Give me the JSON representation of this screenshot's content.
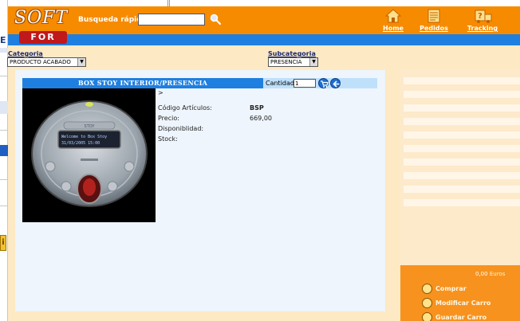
{
  "header": {
    "logo_top": "SOFT",
    "logo_bottom": "FOR YOU",
    "search_label": "Busqueda rápida",
    "search_value": "",
    "nav": [
      {
        "label": "Home",
        "icon": "home-icon"
      },
      {
        "label": "Pedidos",
        "icon": "document-icon"
      },
      {
        "label": "Tracking",
        "icon": "tracking-icon"
      }
    ]
  },
  "filters": {
    "categoria_label": "Categoria",
    "categoria_value": "PRODUCTO ACABADO",
    "subcategoria_label": "Subcategoria",
    "subcategoria_value": "PRESENCIA"
  },
  "product": {
    "title": "BOX STOY INTERIOR/PRESENCIA",
    "cantidad_label": "Cantidad:",
    "cantidad_value": "1",
    "breadcrumb": ">",
    "details": [
      {
        "label": "Código Artículos:",
        "value": "BSP"
      },
      {
        "label": "Precio:",
        "value": "669,00"
      },
      {
        "label": "Disponiblidad:",
        "value": ""
      },
      {
        "label": "Stock:",
        "value": ""
      }
    ],
    "device_screen_text_line1": "Welcome to Box Stoy",
    "device_screen_text_line2": "31/03/2005   15:00",
    "device_brand": "STOY"
  },
  "cart": {
    "total": "0,00",
    "currency": "Euros",
    "actions": [
      {
        "label": "Comprar"
      },
      {
        "label": "Modificar Carro"
      },
      {
        "label": "Guardar Carro"
      }
    ]
  },
  "colors": {
    "header_orange": "#f78b00",
    "nav_blue": "#1f7fe0",
    "cream": "#fde9c3",
    "panel": "#eef5fc"
  }
}
